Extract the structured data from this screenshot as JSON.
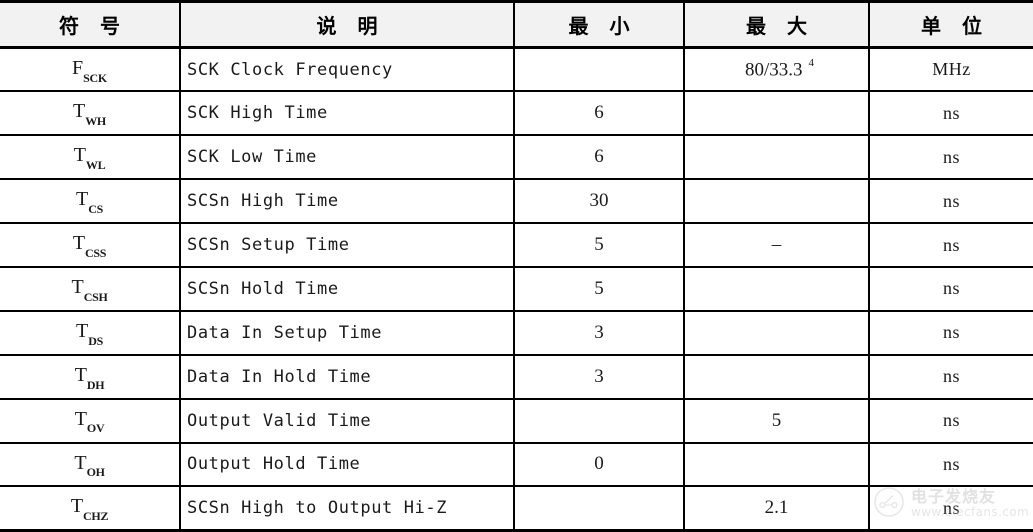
{
  "table": {
    "columns": [
      {
        "key": "symbol",
        "label": "符 号"
      },
      {
        "key": "description",
        "label": "说 明"
      },
      {
        "key": "min",
        "label": "最 小"
      },
      {
        "key": "max",
        "label": "最 大"
      },
      {
        "key": "unit",
        "label": "单 位"
      }
    ],
    "rows": [
      {
        "symbol_base": "F",
        "symbol_sub": "SCK",
        "description": "SCK Clock Frequency",
        "min": "",
        "max": "80/33.3",
        "max_note": "4",
        "unit": "MHz"
      },
      {
        "symbol_base": "T",
        "symbol_sub": "WH",
        "description": "SCK High Time",
        "min": "6",
        "max": "",
        "max_note": "",
        "unit": "ns"
      },
      {
        "symbol_base": "T",
        "symbol_sub": "WL",
        "description": "SCK Low Time",
        "min": "6",
        "max": "",
        "max_note": "",
        "unit": "ns"
      },
      {
        "symbol_base": "T",
        "symbol_sub": "CS",
        "description": "SCSn High Time",
        "min": "30",
        "max": "",
        "max_note": "",
        "unit": "ns"
      },
      {
        "symbol_base": "T",
        "symbol_sub": "CSS",
        "description": "SCSn Setup Time",
        "min": "5",
        "max": "–",
        "max_note": "",
        "unit": "ns"
      },
      {
        "symbol_base": "T",
        "symbol_sub": "CSH",
        "description": "SCSn Hold Time",
        "min": "5",
        "max": "",
        "max_note": "",
        "unit": "ns"
      },
      {
        "symbol_base": "T",
        "symbol_sub": "DS",
        "description": "Data In Setup Time",
        "min": "3",
        "max": "",
        "max_note": "",
        "unit": "ns"
      },
      {
        "symbol_base": "T",
        "symbol_sub": "DH",
        "description": "Data In Hold Time",
        "min": "3",
        "max": "",
        "max_note": "",
        "unit": "ns"
      },
      {
        "symbol_base": "T",
        "symbol_sub": "OV",
        "description": "Output Valid Time",
        "min": "",
        "max": "5",
        "max_note": "",
        "unit": "ns"
      },
      {
        "symbol_base": "T",
        "symbol_sub": "OH",
        "description": "Output Hold Time",
        "min": "0",
        "max": "",
        "max_note": "",
        "unit": "ns"
      },
      {
        "symbol_base": "T",
        "symbol_sub": "CHZ",
        "description": "SCSn High to Output Hi-Z",
        "min": "",
        "max": "2.1",
        "max_note": "",
        "unit": "ns"
      }
    ]
  },
  "watermark": {
    "brand_cn": "电子发烧友",
    "url": "www.elecfans.com"
  },
  "colors": {
    "header_bg": "#f2f2f2",
    "row_bg": "#ffffff",
    "border": "#000000",
    "text": "#1a1a1a",
    "watermark_text": "#bdbdbd"
  }
}
